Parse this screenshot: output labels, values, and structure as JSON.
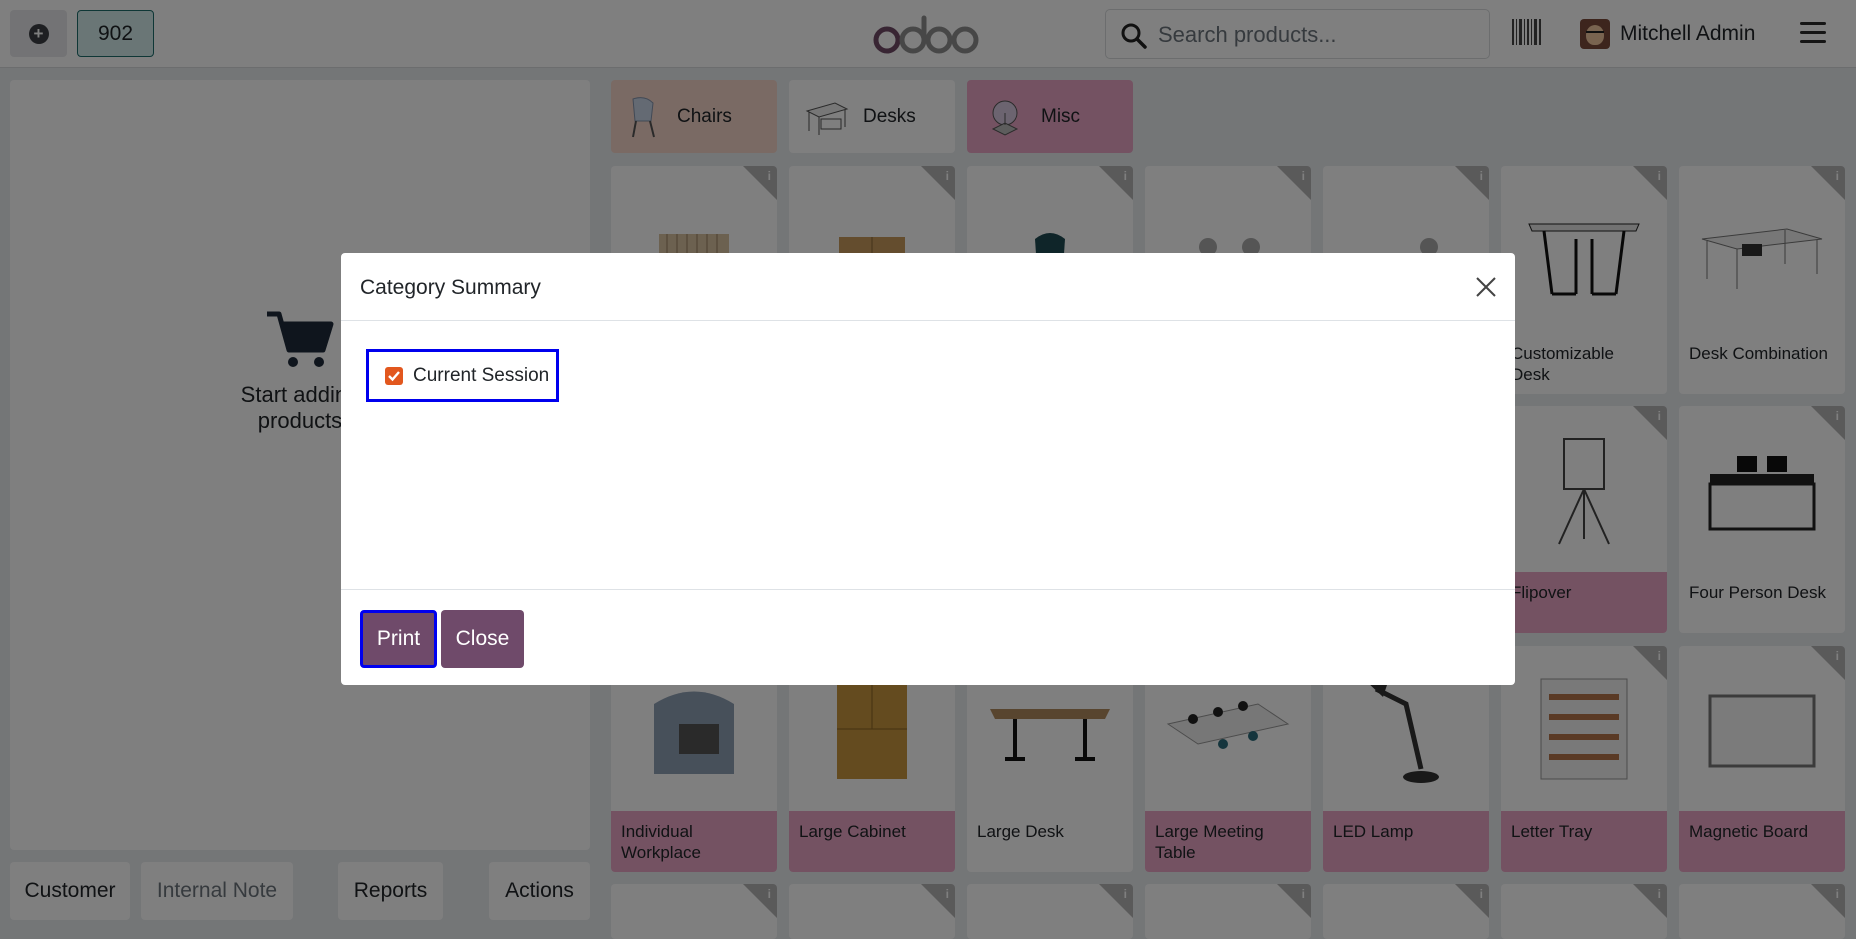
{
  "topbar": {
    "order_number": "902",
    "search_placeholder": "Search products...",
    "user_name": "Mitchell Admin"
  },
  "left": {
    "empty_text": "Start adding products",
    "buttons": {
      "customer": "Customer",
      "internal_note": "Internal Note",
      "reports": "Reports",
      "actions": "Actions"
    }
  },
  "categories": [
    {
      "label": "Chairs",
      "color": "#f4d5c8"
    },
    {
      "label": "Desks",
      "color": "#ffffff"
    },
    {
      "label": "Misc",
      "color": "#e9a5c4"
    }
  ],
  "products": {
    "row1": [
      {
        "name": "",
        "pink": false
      },
      {
        "name": "",
        "pink": false
      },
      {
        "name": "",
        "pink": false
      },
      {
        "name": "",
        "pink": false
      },
      {
        "name": "",
        "pink": false
      },
      {
        "name": "Customizable Desk",
        "pink": false
      },
      {
        "name": "Desk Combination",
        "pink": false
      }
    ],
    "row2": [
      {
        "name": "Flipover",
        "pink": true
      },
      {
        "name": "Four Person Desk",
        "pink": false
      }
    ],
    "row3": [
      {
        "name": "Individual Workplace",
        "pink": true
      },
      {
        "name": "Large Cabinet",
        "pink": true
      },
      {
        "name": "Large Desk",
        "pink": false
      },
      {
        "name": "Large Meeting Table",
        "pink": true
      },
      {
        "name": "LED Lamp",
        "pink": true
      },
      {
        "name": "Letter Tray",
        "pink": true
      },
      {
        "name": "Magnetic Board",
        "pink": true
      }
    ]
  },
  "modal": {
    "title": "Category Summary",
    "checkbox_label": "Current Session",
    "checkbox_checked": true,
    "print_label": "Print",
    "close_label": "Close"
  },
  "colors": {
    "primary": "#6f4a6a",
    "checkbox": "#e2571e",
    "focus_outline": "#0000ee",
    "pink_category": "#e9a5c4"
  }
}
